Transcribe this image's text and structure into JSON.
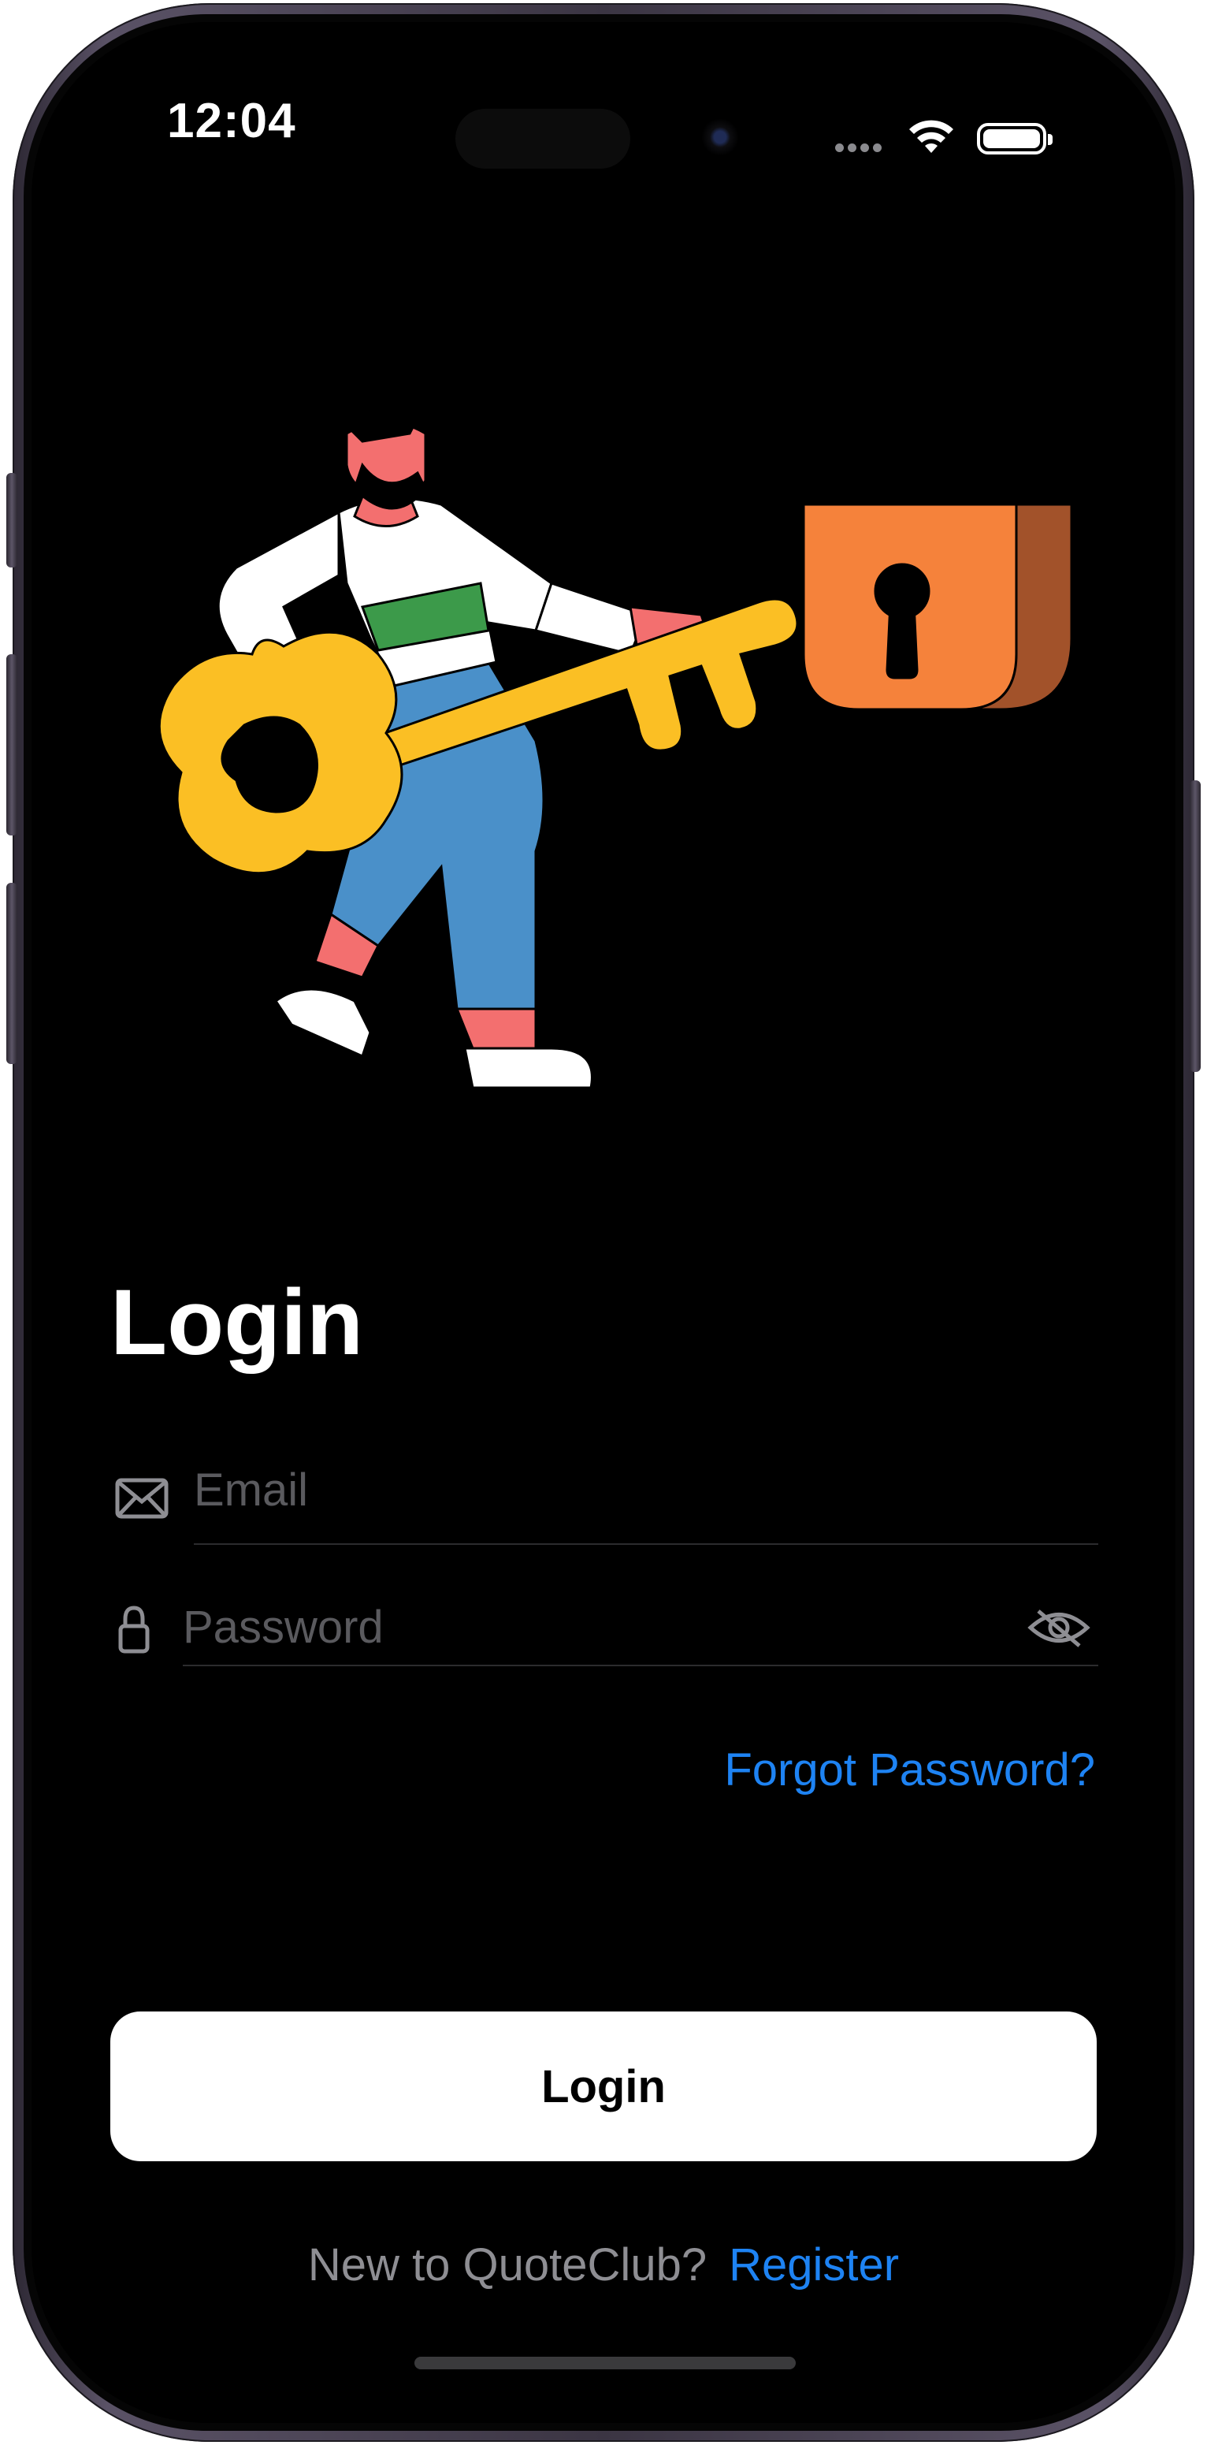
{
  "status_bar": {
    "time": "12:04",
    "icons": [
      "cellular-dots-icon",
      "wifi-icon",
      "battery-icon"
    ]
  },
  "illustration": {
    "name": "man-with-key-and-lock"
  },
  "login": {
    "title": "Login",
    "email": {
      "placeholder": "Email",
      "value": "",
      "icon": "envelope-icon"
    },
    "password": {
      "placeholder": "Password",
      "value": "",
      "icon": "lock-icon",
      "toggle_icon": "eye-slash-icon"
    },
    "forgot_password": "Forgot Password?",
    "submit_label": "Login",
    "register_prompt": "New to QuoteClub?",
    "register_link": "Register"
  },
  "colors": {
    "background": "#000000",
    "accent": "#1E83F3",
    "button_bg": "#FFFFFF",
    "placeholder": "#5A5A5E",
    "secondary_text": "#8E8E93"
  }
}
